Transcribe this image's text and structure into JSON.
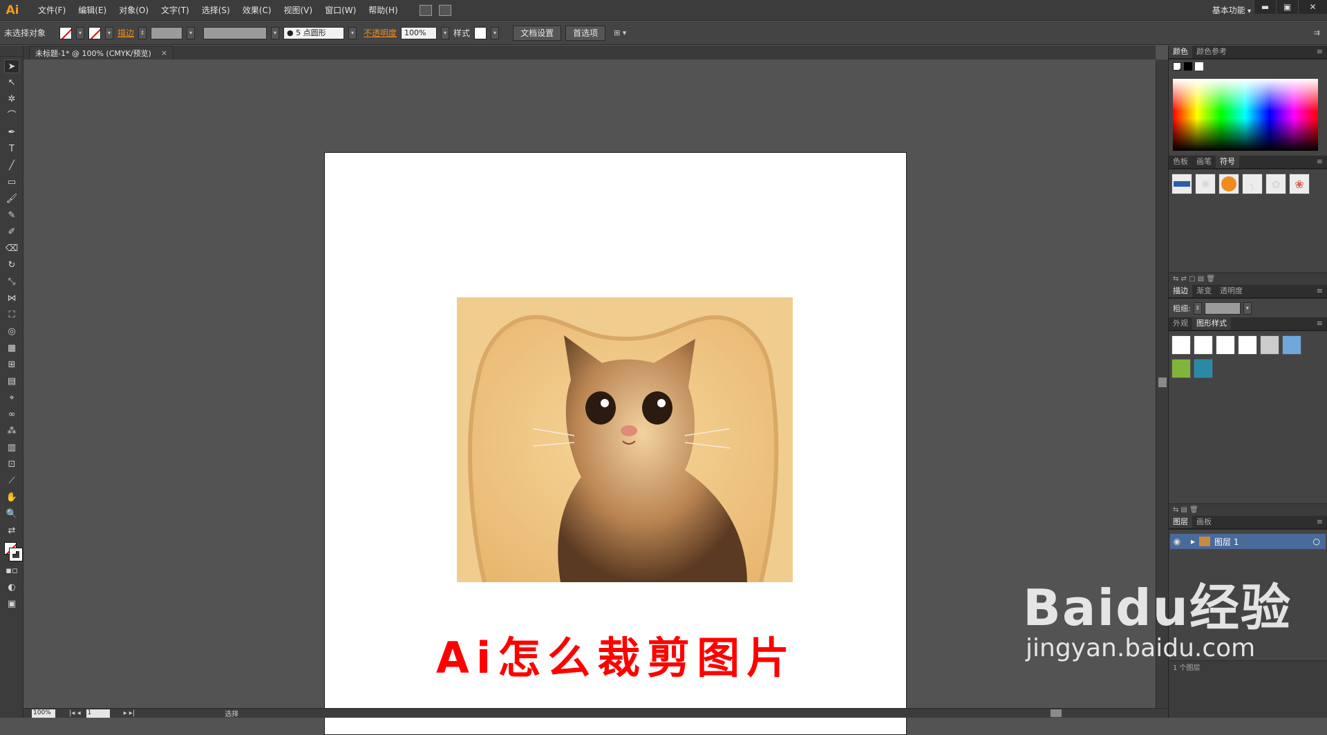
{
  "app": {
    "logo": "Ai"
  },
  "menu": [
    "文件(F)",
    "编辑(E)",
    "对象(O)",
    "文字(T)",
    "选择(S)",
    "效果(C)",
    "视图(V)",
    "窗口(W)",
    "帮助(H)"
  ],
  "workspace": "基本功能",
  "window_controls": {
    "min": "▬",
    "max": "▣",
    "close": "✕"
  },
  "control_bar": {
    "selection": "未选择对象",
    "stroke_label": "描边",
    "brush": "5 点圆形",
    "opacity_label": "不透明度",
    "opacity_value": "100%",
    "style_label": "样式",
    "doc_setup": "文档设置",
    "prefs": "首选项"
  },
  "document_tab": {
    "title": "未标题-1* @ 100% (CMYK/预览)",
    "close": "×"
  },
  "artboard": {
    "headline": "Ai怎么裁剪图片"
  },
  "status": {
    "zoom": "100%",
    "page": "1",
    "mode": "选择"
  },
  "panels": {
    "color": {
      "tabs": [
        "颜色",
        "颜色参考"
      ]
    },
    "swatches": {
      "tabs": [
        "色板",
        "画笔",
        "符号"
      ]
    },
    "stroke": {
      "tabs": [
        "描边",
        "渐变",
        "透明度"
      ],
      "weight_label": "粗细:"
    },
    "appearance": {
      "tabs": [
        "外观",
        "图形样式"
      ]
    },
    "layers": {
      "tabs": [
        "图层",
        "画板"
      ],
      "layer_name": "图层 1",
      "footer": "1 个图层"
    }
  },
  "watermark": {
    "line1": "Baidu经验",
    "line2": "jingyan.baidu.com"
  },
  "colors": {
    "accent": "#f08c1c",
    "headline": "#ff0000",
    "panel_bg": "#3c3c3c",
    "canvas_bg": "#535353"
  }
}
